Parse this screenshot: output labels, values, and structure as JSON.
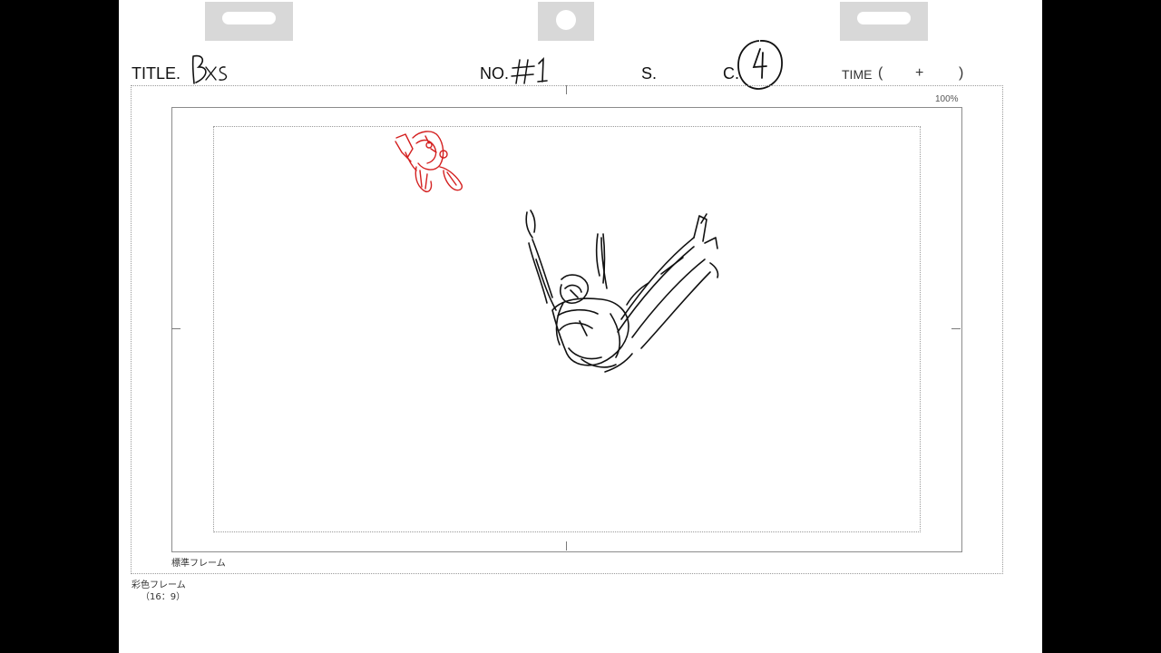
{
  "header": {
    "title_label": "TITLE.",
    "no_label": "NO.",
    "s_label": "S.",
    "c_label": "C.",
    "time_label": "TIME",
    "time_open": "(",
    "time_plus": "+",
    "time_close": ")",
    "handwriting": {
      "title": "BxS",
      "no": "#1",
      "c": "4"
    }
  },
  "canvas": {
    "zoom": "100%",
    "standard_frame_label": "標準フレーム",
    "color_frame_label": "彩色フレーム",
    "color_frame_ratio": "（16：9）"
  },
  "colors": {
    "sketch_black": "#111111",
    "sketch_red": "#d42020",
    "sheet": "#ffffff",
    "background": "#000000",
    "peg": "#d8d8d8"
  }
}
